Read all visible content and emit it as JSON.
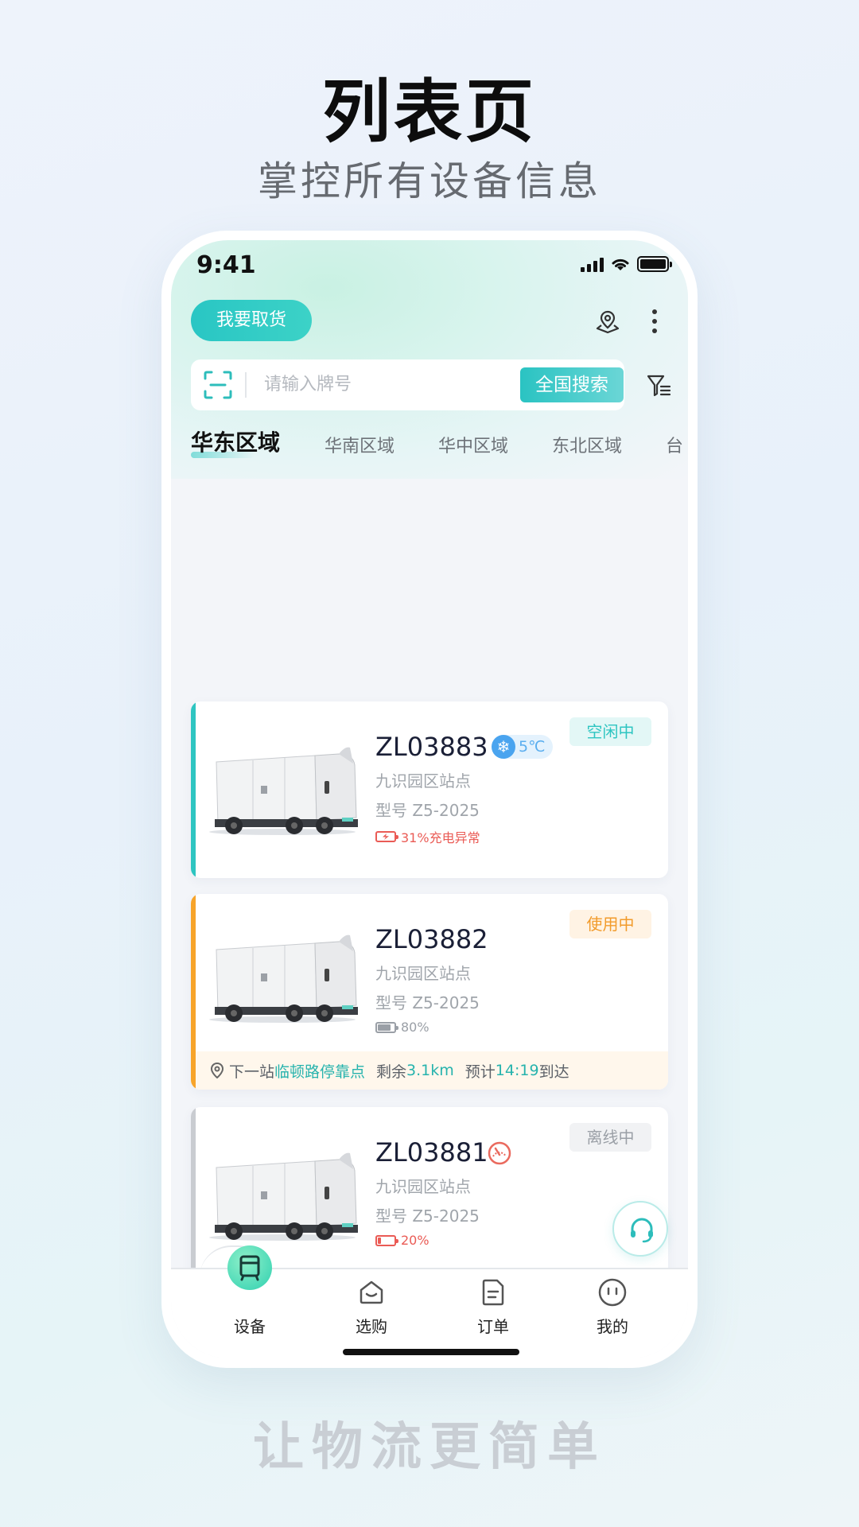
{
  "promo": {
    "title": "列表页",
    "subtitle": "掌控所有设备信息",
    "slogan": "让物流更简单"
  },
  "status_bar": {
    "time": "9:41"
  },
  "header": {
    "pickup_label": "我要取货",
    "map_icon": "map-pin-icon",
    "more_icon": "more-vertical-icon"
  },
  "search": {
    "placeholder": "请输入牌号",
    "value": "",
    "button_label": "全国搜索",
    "scan_icon": "scan-icon",
    "filter_icon": "filter-icon"
  },
  "regions": {
    "tabs": [
      "华东区域",
      "华南区域",
      "华中区域",
      "东北区域",
      "台"
    ],
    "active_index": 0
  },
  "vehicles": [
    {
      "plate": "ZL03883",
      "temperature": "5℃",
      "station": "九识园区站点",
      "model": "型号 Z5-2025",
      "battery_text": "31%充电异常",
      "battery_level": 0.31,
      "status": "空闲中",
      "stripe_color": "#2ec5c1",
      "status_color": "#2ec5c1",
      "status_bg": "#e3f7f6",
      "battery_color": "#ea5b55"
    },
    {
      "plate": "ZL03882",
      "station": "九识园区站点",
      "model": "型号 Z5-2025",
      "battery_text": "80%",
      "battery_level": 0.8,
      "status": "使用中",
      "stripe_color": "#f7a42a",
      "status_color": "#f29b2b",
      "status_bg": "#fff3e4",
      "battery_color": "#9a9fa6",
      "route": {
        "next_label": "下一站",
        "next_stop": "临顿路停靠点",
        "remaining_label": "剩余",
        "remaining": "3.1km",
        "eta_label": "预计",
        "eta": "14:19",
        "arrive_label": "到达"
      }
    },
    {
      "plate": "ZL03881",
      "station": "九识园区站点",
      "model": "型号 Z5-2025",
      "battery_text": "20%",
      "battery_level": 0.2,
      "status": "离线中",
      "stripe_color": "#c9ccd1",
      "status_color": "#9a9fa6",
      "status_bg": "#f1f2f4",
      "battery_color": "#ea5b55",
      "alert_icon": "speedometer-icon"
    }
  ],
  "support_icon": "headset-icon",
  "tabbar": [
    {
      "label": "设备",
      "icon": "vehicle-icon",
      "active": true
    },
    {
      "label": "选购",
      "icon": "shop-icon",
      "active": false
    },
    {
      "label": "订单",
      "icon": "order-icon",
      "active": false
    },
    {
      "label": "我的",
      "icon": "profile-icon",
      "active": false
    }
  ]
}
